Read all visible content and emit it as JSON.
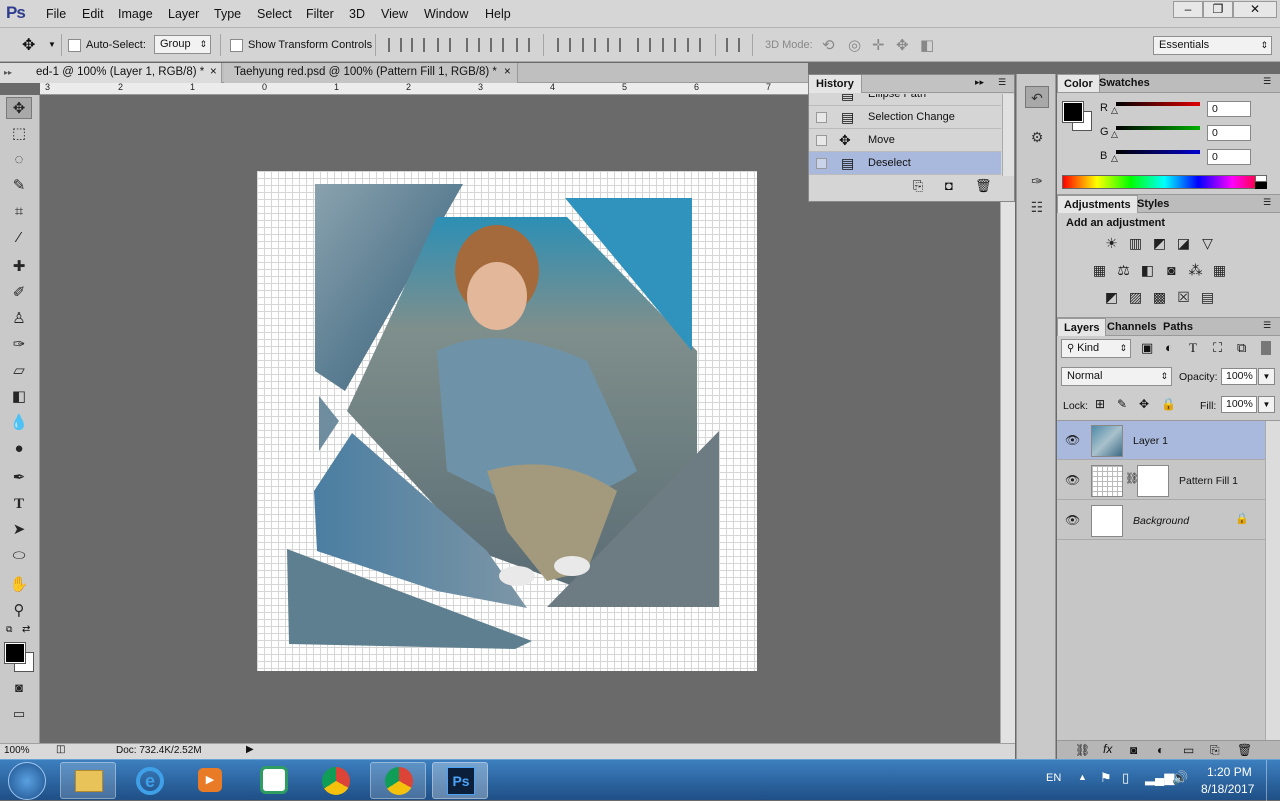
{
  "app": {
    "logo": "Ps",
    "window_controls": [
      "–",
      "❐",
      "✕"
    ]
  },
  "menu": [
    "File",
    "Edit",
    "Image",
    "Layer",
    "Type",
    "Select",
    "Filter",
    "3D",
    "View",
    "Window",
    "Help"
  ],
  "options_bar": {
    "auto_select_label": "Auto-Select:",
    "auto_select_value": "Group",
    "show_transform_label": "Show Transform Controls",
    "mode_3d_label": "3D Mode:",
    "workspace": "Essentials"
  },
  "tabs": [
    {
      "label": "ed-1 @ 100% (Layer 1, RGB/8) *",
      "close": "×",
      "active": true
    },
    {
      "label": "Taehyung red.psd @ 100% (Pattern Fill 1, RGB/8) *",
      "close": "×",
      "active": false
    }
  ],
  "ruler_numbers": [
    "3",
    "2",
    "1",
    "0",
    "1",
    "2",
    "3",
    "4",
    "5",
    "6",
    "7"
  ],
  "status": {
    "zoom": "100%",
    "doc": "Doc: 732.4K/2.52M"
  },
  "history": {
    "title": "History",
    "items": [
      {
        "label": "Ellipse Path",
        "selected": false
      },
      {
        "label": "Selection Change",
        "selected": false
      },
      {
        "label": "Move",
        "selected": false
      },
      {
        "label": "Deselect",
        "selected": true
      }
    ]
  },
  "color_panel": {
    "tabs": [
      "Color",
      "Swatches"
    ],
    "channels": [
      {
        "label": "R",
        "value": "0",
        "color": "#e00000"
      },
      {
        "label": "G",
        "value": "0",
        "color": "#00b000"
      },
      {
        "label": "B",
        "value": "0",
        "color": "#0000d0"
      }
    ]
  },
  "adjustments": {
    "tabs": [
      "Adjustments",
      "Styles"
    ],
    "heading": "Add an adjustment"
  },
  "layers": {
    "tabs": [
      "Layers",
      "Channels",
      "Paths"
    ],
    "kind_label": "Kind",
    "blend_mode": "Normal",
    "opacity_label": "Opacity:",
    "opacity": "100%",
    "lock_label": "Lock:",
    "fill_label": "Fill:",
    "fill": "100%",
    "items": [
      {
        "name": "Layer 1",
        "selected": true
      },
      {
        "name": "Pattern Fill 1",
        "selected": false
      },
      {
        "name": "Background",
        "selected": false
      }
    ]
  },
  "taskbar": {
    "lang": "EN",
    "time": "1:20 PM",
    "date": "8/18/2017",
    "ps_label": "Ps"
  }
}
